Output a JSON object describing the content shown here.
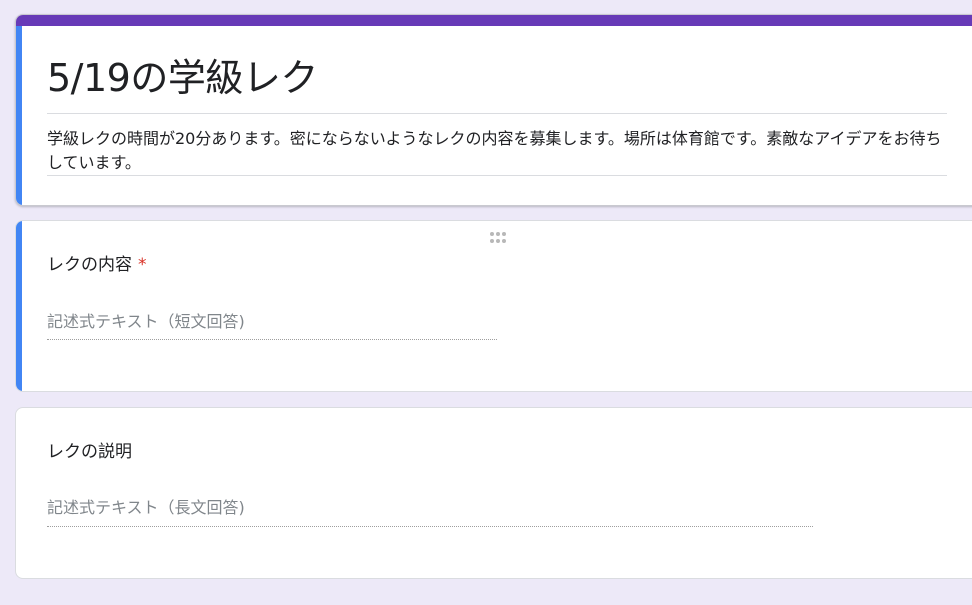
{
  "form": {
    "title": "5/19の学級レク",
    "description": "学級レクの時間が20分あります。密にならないようなレクの内容を募集します。場所は体育館です。素敵なアイデアをお待ちしています。",
    "theme_color": "#673ab7",
    "accent_color": "#4285f4",
    "background_color": "#ede9f8"
  },
  "questions": [
    {
      "title": "レクの内容",
      "required_mark": "*",
      "answer_placeholder": "記述式テキスト（短文回答)"
    },
    {
      "title": "レクの説明",
      "answer_placeholder": "記述式テキスト（長文回答)"
    }
  ],
  "icons": {
    "drag_handle": "drag-handle-icon"
  }
}
